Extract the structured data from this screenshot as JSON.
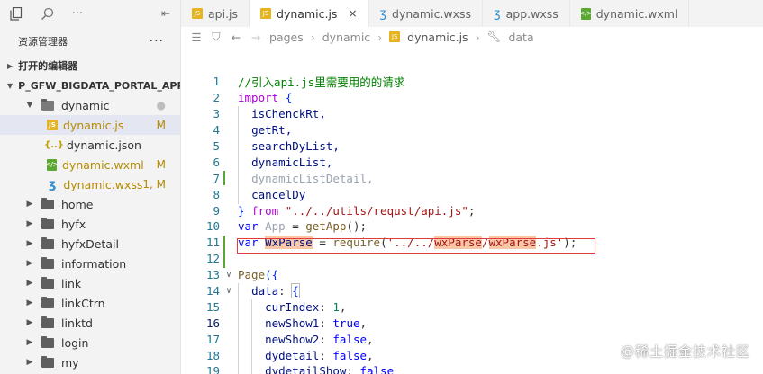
{
  "sidebar": {
    "top_icons": [
      "files-icon",
      "search-icon",
      "more-icon",
      "split-icon"
    ],
    "explorer_title": "资源管理器",
    "explorer_more": "···",
    "open_editors_label": "打开的编辑器",
    "project_label": "P_GFW_BIGDATA_PORTAL_APPLET",
    "items": [
      {
        "label": "dynamic",
        "type": "folder-open",
        "badge": "●"
      },
      {
        "label": "dynamic.js",
        "type": "js",
        "badge": "M"
      },
      {
        "label": "dynamic.json",
        "type": "json",
        "badge": ""
      },
      {
        "label": "dynamic.wxml",
        "type": "wxml",
        "badge": "M"
      },
      {
        "label": "dynamic.wxss",
        "type": "wxss",
        "badge": "1, M"
      },
      {
        "label": "home",
        "type": "folder",
        "badge": ""
      },
      {
        "label": "hyfx",
        "type": "folder",
        "badge": ""
      },
      {
        "label": "hyfxDetail",
        "type": "folder",
        "badge": ""
      },
      {
        "label": "information",
        "type": "folder",
        "badge": ""
      },
      {
        "label": "link",
        "type": "folder",
        "badge": ""
      },
      {
        "label": "linkCtrn",
        "type": "folder",
        "badge": ""
      },
      {
        "label": "linktd",
        "type": "folder",
        "badge": ""
      },
      {
        "label": "login",
        "type": "folder",
        "badge": ""
      },
      {
        "label": "my",
        "type": "folder",
        "badge": ""
      }
    ]
  },
  "tabs": [
    {
      "label": "api.js",
      "icon": "js",
      "active": false
    },
    {
      "label": "dynamic.js",
      "icon": "js",
      "active": true,
      "close": "×"
    },
    {
      "label": "dynamic.wxss",
      "icon": "wxss",
      "active": false
    },
    {
      "label": "app.wxss",
      "icon": "wxss",
      "active": false
    },
    {
      "label": "dynamic.wxml",
      "icon": "wxml",
      "active": false
    }
  ],
  "breadcrumb": {
    "path": [
      "pages",
      "dynamic",
      "dynamic.js",
      "data"
    ]
  },
  "editor": {
    "line_numbers": [
      "1",
      "2",
      "3",
      "4",
      "5",
      "6",
      "7",
      "8",
      "9",
      "10",
      "11",
      "12",
      "13",
      "14",
      "15",
      "16",
      "17",
      "18",
      "19"
    ],
    "lines": {
      "l1": "//引入api.js里需要用的的请求",
      "l2_kw": "import",
      "l2_br": "{",
      "l3": "isChenckRt,",
      "l4": "getRt,",
      "l5": "searchDyList,",
      "l6": "dynamicList,",
      "l7": "dynamicListDetail,",
      "l8": "cancelDy",
      "l9_br": "}",
      "l9_kw": "from",
      "l9_str": "\"../../utils/requst/api.js\"",
      "l9_end": ";",
      "l10_kw": "var",
      "l10_var": "App",
      "l10_eq": " = ",
      "l10_fn": "getApp",
      "l10_end": "();",
      "l11_kw": "var",
      "l11_var": "WxParse",
      "l11_eq": " = ",
      "l11_fn": "require",
      "l11_open": "(",
      "l11_str_a": "'../../",
      "l11_str_b": "wxParse",
      "l11_str_c": "/",
      "l11_str_d": "wxParse",
      "l11_str_e": ".js'",
      "l11_end": ");",
      "l13_fn": "Page",
      "l13_br": "({",
      "l14_key": "data",
      "l14_colon": ": ",
      "l14_br": "{",
      "l15_key": "curIndex",
      "l15_val": "1",
      "l16_key": "newShow1",
      "l16_val": "true",
      "l17_key": "newShow2",
      "l17_val": "false",
      "l18_key": "dydetail",
      "l18_val": "false",
      "l19_key": "dydetailShow",
      "l19_val": "false"
    }
  },
  "watermark": "@稀土掘金技术社区"
}
